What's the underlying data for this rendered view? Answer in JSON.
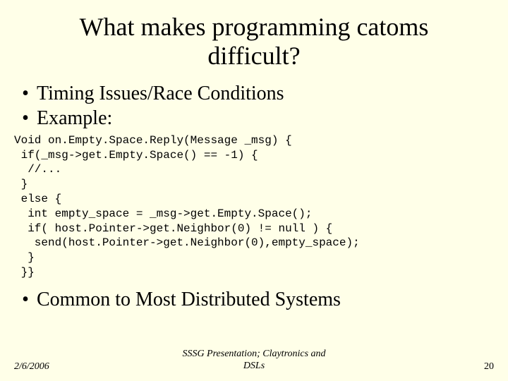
{
  "title_line1": "What makes programming catoms",
  "title_line2": "difficult?",
  "bullets": {
    "b0": "Timing Issues/Race Conditions",
    "b1": "Example:",
    "b2": "Common to Most Distributed Systems"
  },
  "code": "Void on.Empty.Space.Reply(Message _msg) {\n if(_msg->get.Empty.Space() == -1) {\n  //...\n }\n else {\n  int empty_space = _msg->get.Empty.Space();\n  if( host.Pointer->get.Neighbor(0) != null ) {\n   send(host.Pointer->get.Neighbor(0),empty_space);\n  }\n }}",
  "footer": {
    "date": "2/6/2006",
    "center_line1": "SSSG Presentation; Claytronics and",
    "center_line2": "DSLs",
    "page": "20"
  },
  "bullet_glyph": "•"
}
